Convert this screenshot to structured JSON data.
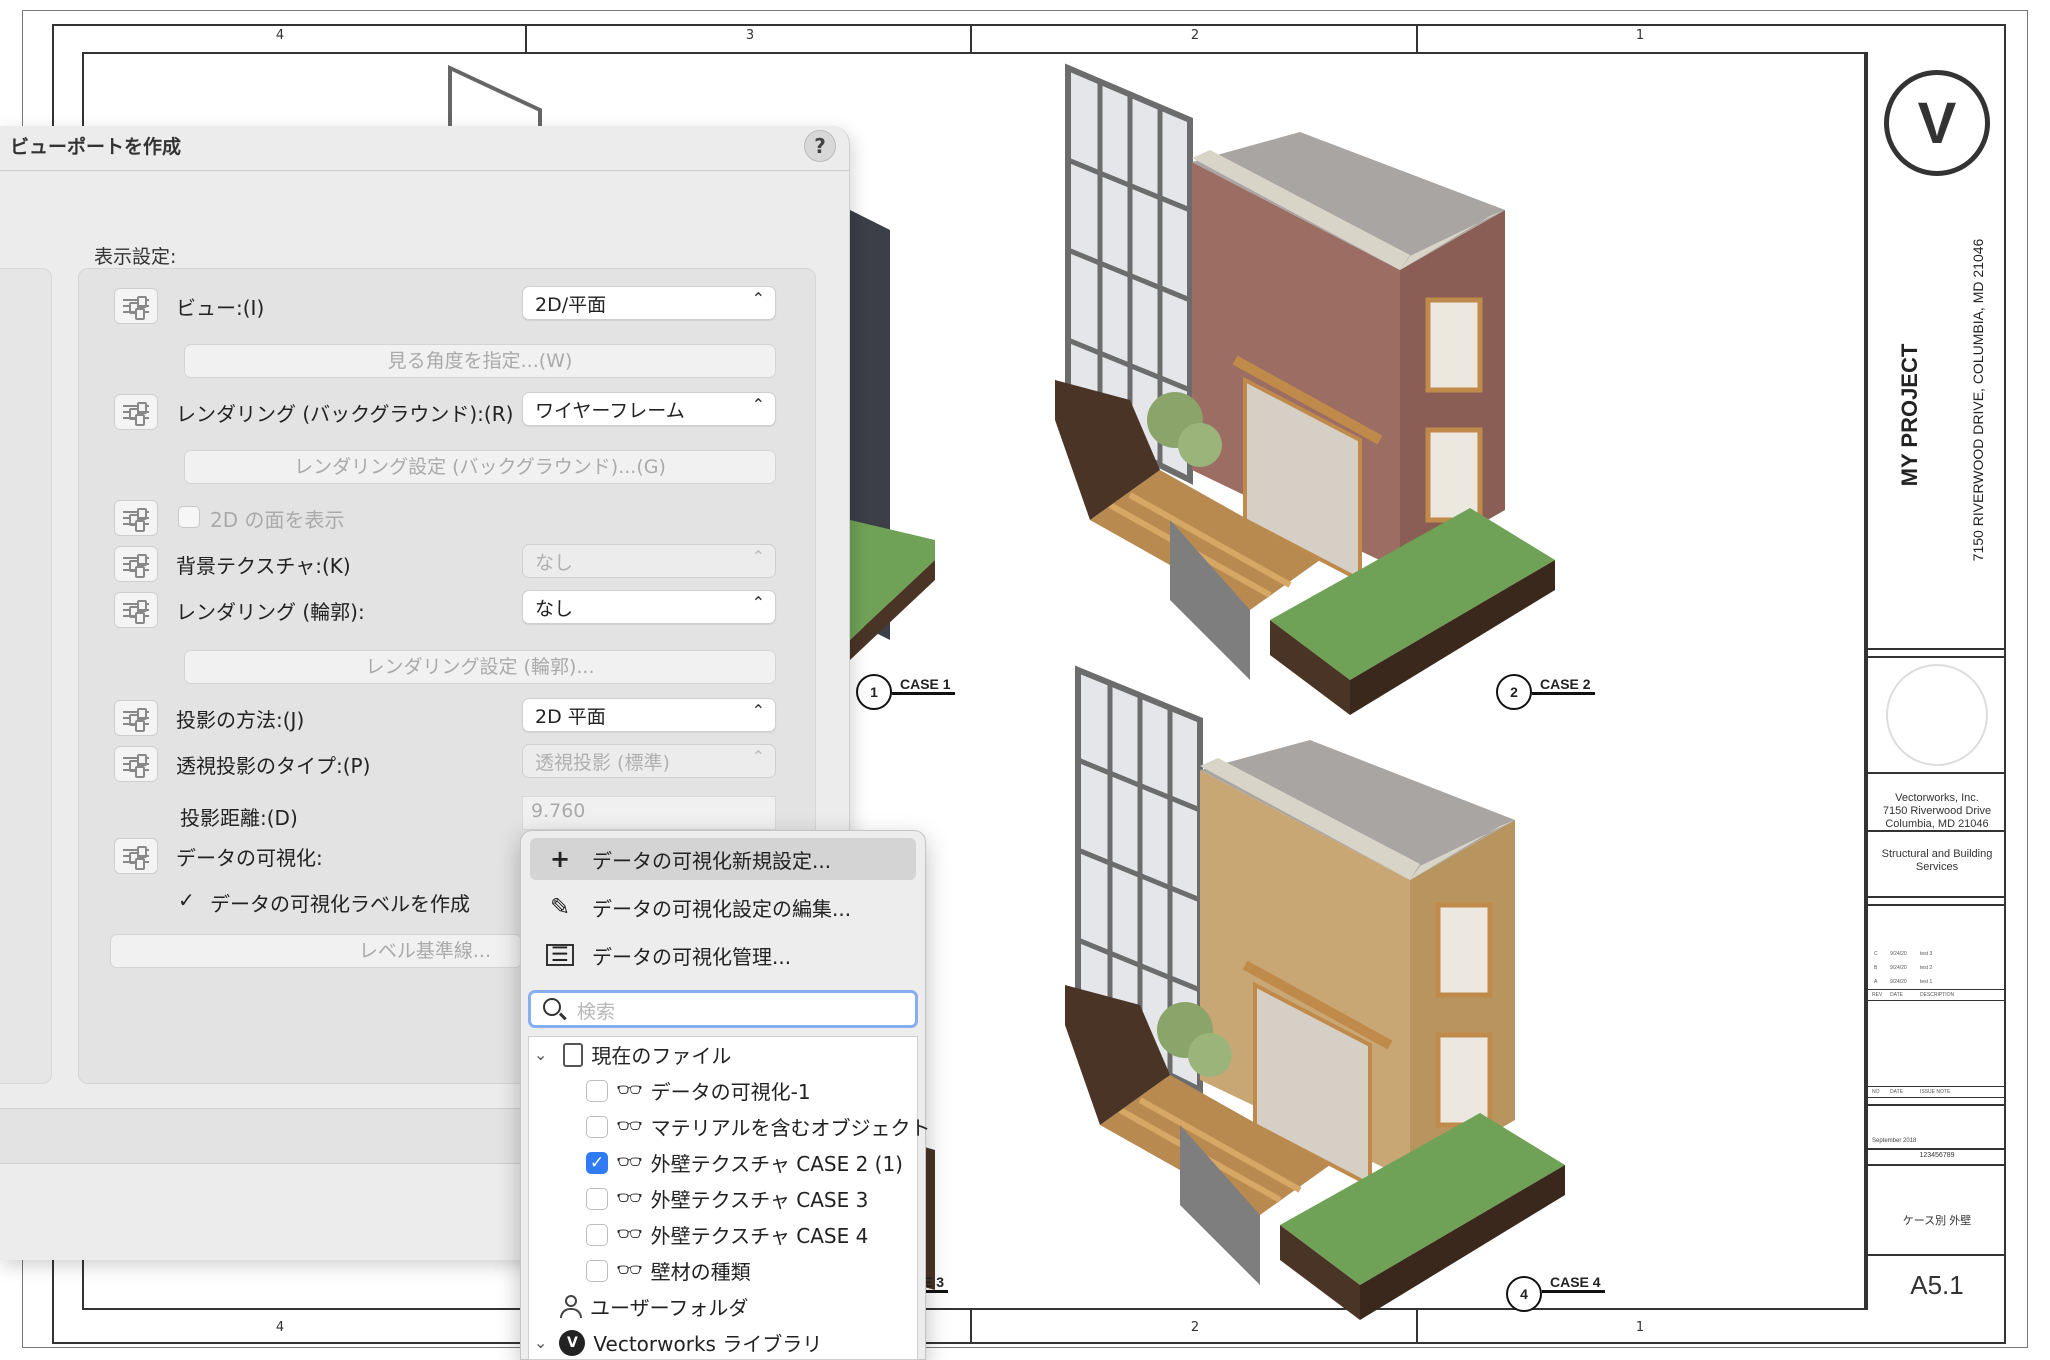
{
  "sheet": {
    "zones": [
      "4",
      "3",
      "2",
      "1"
    ],
    "project_title": "MY PROJECT",
    "address": "7150 RIVERWOOD DRIVE, COLUMBIA, MD 21046",
    "architect": [
      "Vectorworks, Inc.",
      "7150 Riverwood Drive",
      "Columbia, MD 21046"
    ],
    "consultant": [
      "Structural and Building",
      "Services"
    ],
    "revisions": [
      {
        "rev": "C",
        "date": "9/24/20",
        "desc": "test 3"
      },
      {
        "rev": "B",
        "date": "9/24/20",
        "desc": "test 2"
      },
      {
        "rev": "A",
        "date": "9/24/20",
        "desc": "test 1"
      }
    ],
    "rev_header": {
      "rev": "REV",
      "date": "DATE",
      "desc": "DESCRIPTION"
    },
    "issue_header": {
      "no": "NO",
      "date": "DATE",
      "note": "ISSUE NOTE"
    },
    "date_value": "September 2018",
    "project_id": "123456789",
    "sheet_title": "ケース別 外壁",
    "sheet_number": "A5.1",
    "markers": [
      {
        "num": "1",
        "label": "CASE 1"
      },
      {
        "num": "2",
        "label": "CASE 2"
      },
      {
        "num": "",
        "label": "E 3"
      },
      {
        "num": "4",
        "label": "CASE 4"
      }
    ],
    "colors": {
      "brick": "#9b6d63",
      "stone": "#c9a775",
      "grass": "#6fa257",
      "soil": "#4a3426"
    }
  },
  "dialog": {
    "title": "ビューポートを作成",
    "help": "?",
    "group_label": "表示設定:",
    "view_label": "ビュー:(I)",
    "view_value": "2D/平面",
    "angle_button": "見る角度を指定...(W)",
    "render_bg_label": "レンダリング (バックグラウンド):(R)",
    "render_bg_value": "ワイヤーフレーム",
    "render_bg_button": "レンダリング設定 (バックグラウンド)...(G)",
    "show_2d_label": "2D の面を表示",
    "bg_texture_label": "背景テクスチャ:(K)",
    "bg_texture_value": "なし",
    "render_outline_label": "レンダリング (輪郭):",
    "render_outline_value": "なし",
    "render_outline_button": "レンダリング設定 (輪郭)...",
    "projection_label": "投影の方法:(J)",
    "projection_value": "2D 平面",
    "perspective_label": "透視投影のタイプ:(P)",
    "perspective_value": "透視投影 (標準)",
    "distance_label": "投影距離:(D)",
    "distance_value": "9.760",
    "datavis_label": "データの可視化:",
    "datavis_check_label": "データの可視化ラベルを作成",
    "level_button": "レベル基準線..."
  },
  "popup": {
    "menu": [
      {
        "icon": "plus-icon",
        "label": "データの可視化新規設定..."
      },
      {
        "icon": "pencil-icon",
        "label": "データの可視化設定の編集..."
      },
      {
        "icon": "list-icon",
        "label": "データの可視化管理..."
      }
    ],
    "search_placeholder": "検索",
    "tree_root": "現在のファイル",
    "items": [
      {
        "label": "データの可視化-1",
        "checked": false
      },
      {
        "label": "マテリアルを含むオブジェクト",
        "checked": false
      },
      {
        "label": "外壁テクスチャ CASE 2 (1)",
        "checked": true
      },
      {
        "label": "外壁テクスチャ CASE 3",
        "checked": false
      },
      {
        "label": "外壁テクスチャ CASE 4",
        "checked": false
      },
      {
        "label": "壁材の種類",
        "checked": false
      }
    ],
    "user_folder": "ユーザーフォルダ",
    "library": "Vectorworks ライブラリ"
  }
}
